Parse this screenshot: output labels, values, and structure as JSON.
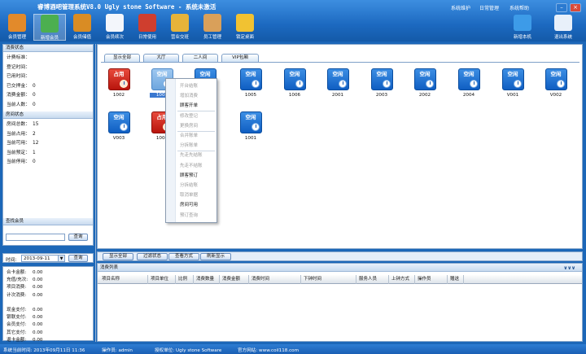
{
  "app_title": "睿博酒吧管理系统V8.0 Ugly  stone Software - 系统未激活",
  "top_links": [
    "系统维护",
    "日常管理",
    "系统帮助"
  ],
  "window_buttons": {
    "minimize": "–",
    "close": "×"
  },
  "toolbar": [
    {
      "label": "会员管理",
      "icon": "members-icon",
      "color": "#e28a2b"
    },
    {
      "label": "新增会员",
      "icon": "add-member-icon",
      "color": "#4caf50"
    },
    {
      "label": "会员储值",
      "icon": "deposit-icon",
      "color": "#d98c24"
    },
    {
      "label": "会员续次",
      "icon": "renew-icon",
      "color": "#f3f6fb"
    },
    {
      "label": "日常使用",
      "icon": "daily-icon",
      "color": "#cf3e2e"
    },
    {
      "label": "营业交班",
      "icon": "handover-icon",
      "color": "#e6b33a"
    },
    {
      "label": "员工管理",
      "icon": "staff-icon",
      "color": "#d9a05a"
    },
    {
      "label": "锁定桌面",
      "icon": "lock-icon",
      "color": "#f1c232"
    }
  ],
  "right_toolbar": [
    {
      "label": "新增本机",
      "icon": "monitor-icon",
      "color": "#3d9be8"
    },
    {
      "label": "退出系统",
      "icon": "exit-icon",
      "color": "#e8f0fa"
    }
  ],
  "consumption_status": {
    "title": "消费状态",
    "rows": [
      {
        "label": "计费标准：",
        "value": ""
      },
      {
        "label": "登记时间：",
        "value": ""
      },
      {
        "label": "已用时间：",
        "value": ""
      },
      {
        "label": "已交押金：",
        "value": "0"
      },
      {
        "label": "消费金额：",
        "value": "0"
      },
      {
        "label": "当前人数：",
        "value": "0"
      }
    ]
  },
  "room_status": {
    "title": "房间状态",
    "rows": [
      {
        "label": "房间总数：",
        "value": "15"
      },
      {
        "label": "当前占用：",
        "value": "2"
      },
      {
        "label": "当前可用：",
        "value": "12"
      },
      {
        "label": "当前预定：",
        "value": "1"
      },
      {
        "label": "当前停用：",
        "value": "0"
      }
    ]
  },
  "member_search": {
    "title": "查找会员",
    "value": "",
    "button": "查询"
  },
  "time_filter": {
    "label": "时间:",
    "value": "2013-09-11",
    "button": "查询"
  },
  "stats": [
    {
      "label": "合卡金额:",
      "value": "0.00"
    },
    {
      "label": "充值/充次:",
      "value": "0.00"
    },
    {
      "label": "项目消费:",
      "value": "0.00"
    },
    {
      "label": "计次消费:",
      "value": "0.00"
    },
    {
      "label": "",
      "value": ""
    },
    {
      "label": "现金支付:",
      "value": "0.00"
    },
    {
      "label": "银联支付:",
      "value": "0.00"
    },
    {
      "label": "会员支付:",
      "value": "0.00"
    },
    {
      "label": "其它支付:",
      "value": "0.00"
    },
    {
      "label": "退卡金额:",
      "value": "0.00"
    }
  ],
  "tabs": [
    "显示全部",
    "大厅",
    "二人间",
    "VIP包厢"
  ],
  "rooms": [
    {
      "status": "占用",
      "number": "1002",
      "state": "busy"
    },
    {
      "status": "空闲",
      "number": "1003",
      "state": "sel"
    },
    {
      "status": "空闲",
      "number": "1004",
      "state": "free"
    },
    {
      "status": "空闲",
      "number": "1005",
      "state": "free"
    },
    {
      "status": "空闲",
      "number": "1006",
      "state": "free"
    },
    {
      "status": "空闲",
      "number": "2001",
      "state": "free"
    },
    {
      "status": "空闲",
      "number": "2003",
      "state": "free"
    },
    {
      "status": "空闲",
      "number": "2002",
      "state": "free"
    },
    {
      "status": "空闲",
      "number": "2004",
      "state": "free"
    },
    {
      "status": "空闲",
      "number": "V001",
      "state": "free"
    },
    {
      "status": "空闲",
      "number": "V002",
      "state": "free"
    },
    {
      "status": "空闲",
      "number": "V003",
      "state": "free"
    },
    {
      "status": "占用",
      "number": "1004",
      "state": "busy"
    },
    {
      "status": "空闲",
      "number": "",
      "state": "free"
    },
    {
      "status": "空闲",
      "number": "1001",
      "state": "free"
    }
  ],
  "context_menu": [
    {
      "label": "开台结账",
      "enabled": false
    },
    {
      "label": "增加消费",
      "enabled": false
    },
    {
      "label": "顾客开单",
      "enabled": true,
      "sep_after": true
    },
    {
      "label": "修改登记",
      "enabled": false
    },
    {
      "label": "更换房间",
      "enabled": false,
      "sep_after": true
    },
    {
      "label": "合并账单",
      "enabled": false
    },
    {
      "label": "分拆账单",
      "enabled": false,
      "sep_after": true
    },
    {
      "label": "先走先结账",
      "enabled": false
    },
    {
      "label": "先走不结账",
      "enabled": false
    },
    {
      "label": "顾客预订",
      "enabled": true
    },
    {
      "label": "分拆结账",
      "enabled": false
    },
    {
      "label": "取消单据",
      "enabled": false
    },
    {
      "label": "房间可用",
      "enabled": true
    },
    {
      "label": "预订查询",
      "enabled": false
    }
  ],
  "action_buttons": [
    "显示全部",
    "过滤状态",
    "查看方式",
    "刷新显示"
  ],
  "consume_list": {
    "title": "消费列表",
    "collapse": "∨∨∨",
    "columns": [
      "项目名称",
      "项目单位",
      "比例",
      "消费数量",
      "消费金额",
      "消费时间",
      "下钟时间",
      "服务人员",
      "上钟方式",
      "操作员",
      "赠送"
    ]
  },
  "status_bar": {
    "login_time": "系统当前时间: 2013年09月11日 11:36",
    "operator": "操作员: admin",
    "licensee": "授权单位: Ugly  stone Software",
    "website": "官方网站: www.coil118.com"
  }
}
